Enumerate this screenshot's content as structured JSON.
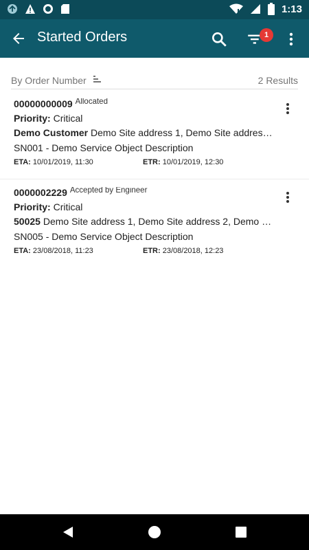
{
  "status_bar": {
    "time": "1:13",
    "icons": [
      "upload-icon",
      "warning-icon",
      "record-icon",
      "sd-card-icon",
      "wifi-icon",
      "signal-icon",
      "battery-icon"
    ]
  },
  "app_bar": {
    "title": "Started Orders",
    "filter_badge": "1",
    "background_color": "#0f5a6b",
    "status_color": "#0c4a58"
  },
  "sort": {
    "label": "By Order Number",
    "results": "2 Results"
  },
  "orders": [
    {
      "number": "00000000009",
      "status": "Allocated",
      "priority_label": "Priority:",
      "priority_value": "Critical",
      "customer": "Demo Customer",
      "address": "Demo Site address 1, Demo Site addres…",
      "service": "SN001 - Demo Service Object Description",
      "eta_label": "ETA:",
      "eta_value": "10/01/2019, 11:30",
      "etr_label": "ETR:",
      "etr_value": "10/01/2019, 12:30"
    },
    {
      "number": "0000002229",
      "status": "Accepted by Engineer",
      "priority_label": "Priority:",
      "priority_value": "Critical",
      "customer": "50025",
      "address": "Demo Site address 1, Demo Site address 2, Demo …",
      "service": "SN005 - Demo Service Object Description",
      "eta_label": "ETA:",
      "eta_value": "23/08/2018, 11:23",
      "etr_label": "ETR:",
      "etr_value": "23/08/2018, 12:23"
    }
  ]
}
